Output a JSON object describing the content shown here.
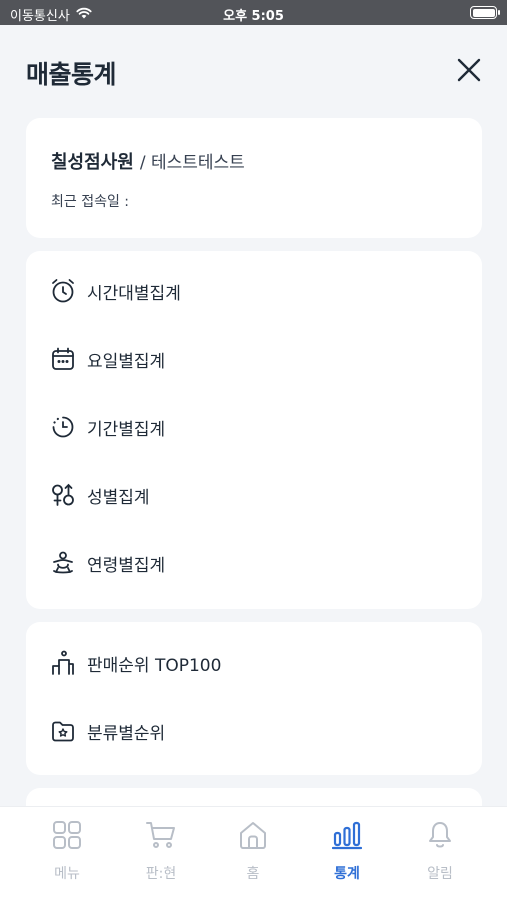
{
  "status_bar": {
    "carrier": "이동통신사",
    "time": "오후 5:05"
  },
  "header": {
    "title": "매출통계"
  },
  "profile": {
    "store_name": "칠성점사원",
    "user_name": "/ 테스트테스트",
    "last_login_label": "최근 접속일 :"
  },
  "menu_group_1": {
    "items": [
      {
        "label": "시간대별집계",
        "icon": "alarm-clock-icon"
      },
      {
        "label": "요일별집계",
        "icon": "calendar-icon"
      },
      {
        "label": "기간별집계",
        "icon": "period-clock-icon"
      },
      {
        "label": "성별집계",
        "icon": "gender-icon"
      },
      {
        "label": "연령별집계",
        "icon": "age-group-icon"
      }
    ]
  },
  "menu_group_2": {
    "items": [
      {
        "label": "판매순위 TOP100",
        "icon": "podium-icon"
      },
      {
        "label": "분류별순위",
        "icon": "category-folder-icon"
      }
    ]
  },
  "tab_bar": {
    "tabs": [
      {
        "label": "메뉴",
        "icon": "grid-icon",
        "active": false
      },
      {
        "label": "판:현",
        "icon": "cart-icon",
        "active": false
      },
      {
        "label": "홈",
        "icon": "home-icon",
        "active": false
      },
      {
        "label": "통계",
        "icon": "bar-chart-icon",
        "active": true
      },
      {
        "label": "알림",
        "icon": "bell-icon",
        "active": false
      }
    ]
  },
  "colors": {
    "background": "#f3f5f8",
    "accent": "#2f6fd6",
    "inactive": "#b8bec7",
    "status_bar": "#525459"
  }
}
